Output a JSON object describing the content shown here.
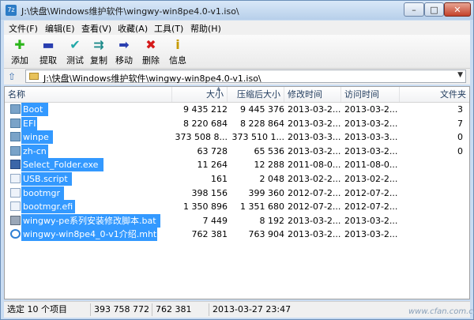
{
  "window": {
    "title": "J:\\快盘\\Windows维护软件\\wingwy-win8pe4.0-v1.iso\\",
    "controls": {
      "minimize": "–",
      "maximize": "□",
      "close": "✕"
    }
  },
  "menu": [
    {
      "label": "文件(F)"
    },
    {
      "label": "编辑(E)"
    },
    {
      "label": "查看(V)"
    },
    {
      "label": "收藏(A)"
    },
    {
      "label": "工具(T)"
    },
    {
      "label": "帮助(H)"
    }
  ],
  "toolbar": [
    {
      "label": "添加",
      "icon": "plus-icon",
      "glyph": "✚",
      "color": "#2bb51a"
    },
    {
      "label": "提取",
      "icon": "minus-icon",
      "glyph": "▬",
      "color": "#2a3fb0"
    },
    {
      "label": "测试",
      "icon": "check-icon",
      "glyph": "✔",
      "color": "#22a8a8"
    },
    {
      "label": "复制",
      "icon": "copy-arrows-icon",
      "glyph": "⇉",
      "color": "#1d8a8a"
    },
    {
      "label": "移动",
      "icon": "move-arrow-icon",
      "glyph": "➡",
      "color": "#2a3fb0"
    },
    {
      "label": "删除",
      "icon": "delete-x-icon",
      "glyph": "✖",
      "color": "#d51a1a"
    },
    {
      "label": "信息",
      "icon": "info-icon",
      "glyph": "i",
      "color": "#c79a00"
    }
  ],
  "address": {
    "up_glyph": "⇧",
    "path": "J:\\快盘\\Windows维护软件\\wingwy-win8pe4.0-v1.iso\\",
    "dropdown_glyph": "▼"
  },
  "columns": [
    {
      "label": "名称"
    },
    {
      "label": "大小"
    },
    {
      "label": "压缩后大小"
    },
    {
      "label": "修改时间"
    },
    {
      "label": "访问时间"
    },
    {
      "label": "文件夹"
    }
  ],
  "files": [
    {
      "name": "Boot",
      "icon": "folder-icon",
      "size": "9 435 212",
      "packed": "9 445 376",
      "modified": "2013-03-2...",
      "accessed": "2013-03-2...",
      "folders": "3"
    },
    {
      "name": "EFI",
      "icon": "folder-icon",
      "size": "8 220 684",
      "packed": "8 228 864",
      "modified": "2013-03-2...",
      "accessed": "2013-03-2...",
      "folders": "7"
    },
    {
      "name": "winpe",
      "icon": "folder-icon",
      "size": "373 508 8...",
      "packed": "373 510 1...",
      "modified": "2013-03-3...",
      "accessed": "2013-03-3...",
      "folders": "0"
    },
    {
      "name": "zh-cn",
      "icon": "folder-icon",
      "size": "63 728",
      "packed": "65 536",
      "modified": "2013-03-2...",
      "accessed": "2013-03-2...",
      "folders": "0"
    },
    {
      "name": "Select_Folder.exe",
      "icon": "exe-icon",
      "size": "11 264",
      "packed": "12 288",
      "modified": "2011-08-0...",
      "accessed": "2011-08-0...",
      "folders": ""
    },
    {
      "name": "USB.script",
      "icon": "file-icon",
      "size": "161",
      "packed": "2 048",
      "modified": "2013-02-2...",
      "accessed": "2013-02-2...",
      "folders": ""
    },
    {
      "name": "bootmgr",
      "icon": "file-icon",
      "size": "398 156",
      "packed": "399 360",
      "modified": "2012-07-2...",
      "accessed": "2012-07-2...",
      "folders": ""
    },
    {
      "name": "bootmgr.efi",
      "icon": "file-icon",
      "size": "1 350 896",
      "packed": "1 351 680",
      "modified": "2012-07-2...",
      "accessed": "2012-07-2...",
      "folders": ""
    },
    {
      "name": "wingwy-pe系列安装修改脚本.bat",
      "icon": "bat-icon",
      "size": "7 449",
      "packed": "8 192",
      "modified": "2013-03-2...",
      "accessed": "2013-03-2...",
      "folders": ""
    },
    {
      "name": "wingwy-win8pe4_0-v1介绍.mht",
      "icon": "mht-icon",
      "size": "762 381",
      "packed": "763 904",
      "modified": "2013-03-2...",
      "accessed": "2013-03-2...",
      "folders": ""
    }
  ],
  "status": {
    "selected": "选定 10 个项目",
    "total_size": "393 758 772",
    "item_size": "762 381",
    "datetime": "2013-03-27 23:47"
  },
  "watermark": "www.cfan.com.cn"
}
